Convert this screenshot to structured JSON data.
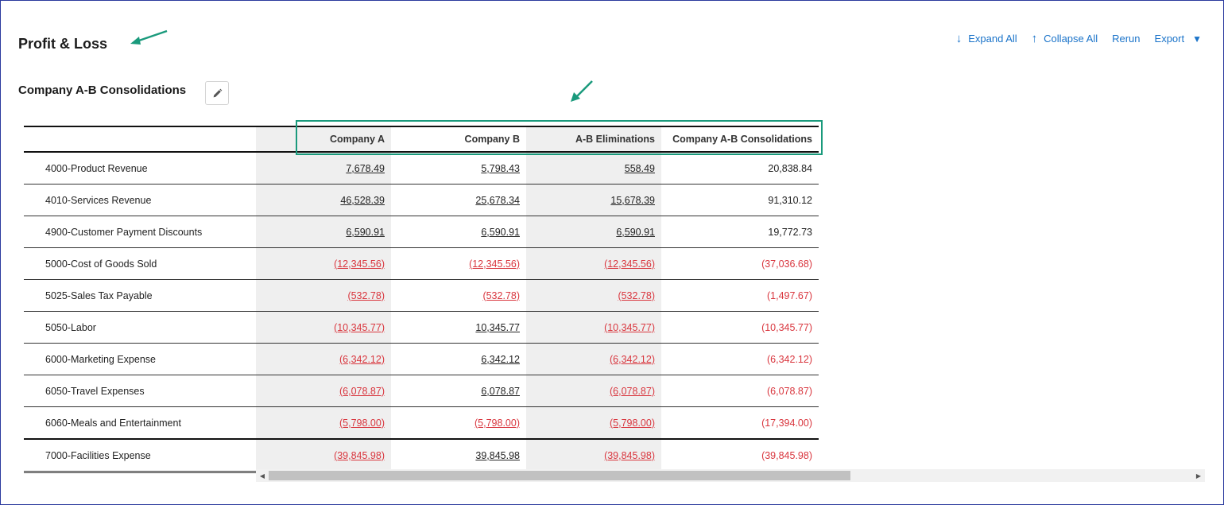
{
  "page": {
    "title": "Profit & Loss"
  },
  "report": {
    "title": "Company A-B Consolidations"
  },
  "toolbar": {
    "expand_all": "Expand All",
    "collapse_all": "Collapse All",
    "rerun": "Rerun",
    "export": "Export"
  },
  "table": {
    "headers": [
      "",
      "Company A",
      "Company B",
      "A-B Eliminations",
      "Company A-B Consolidations"
    ],
    "rows": [
      {
        "label": "4000-Product Revenue",
        "values": [
          "7,678.49",
          "5,798.43",
          "558.49",
          "20,838.84"
        ]
      },
      {
        "label": "4010-Services Revenue",
        "values": [
          "46,528.39",
          "25,678.34",
          "15,678.39",
          "91,310.12"
        ]
      },
      {
        "label": "4900-Customer Payment Discounts",
        "values": [
          "6,590.91",
          "6,590.91",
          "6,590.91",
          "19,772.73"
        ]
      },
      {
        "label": "5000-Cost of Goods Sold",
        "values": [
          "(12,345.56)",
          "(12,345.56)",
          "(12,345.56)",
          "(37,036.68)"
        ]
      },
      {
        "label": "5025-Sales Tax Payable",
        "values": [
          "(532.78)",
          "(532.78)",
          "(532.78)",
          "(1,497.67)"
        ]
      },
      {
        "label": "5050-Labor",
        "values": [
          "(10,345.77)",
          "10,345.77",
          "(10,345.77)",
          "(10,345.77)"
        ]
      },
      {
        "label": "6000-Marketing Expense",
        "values": [
          "(6,342.12)",
          "6,342.12",
          "(6,342.12)",
          "(6,342.12)"
        ]
      },
      {
        "label": "6050-Travel Expenses",
        "values": [
          "(6,078.87)",
          "6,078.87",
          "(6,078.87)",
          "(6,078.87)"
        ]
      },
      {
        "label": "6060-Meals and Entertainment",
        "values": [
          "(5,798.00)",
          "(5,798.00)",
          "(5,798.00)",
          "(17,394.00)"
        ]
      },
      {
        "label": "7000-Facilities Expense",
        "values": [
          "(39,845.98)",
          "39,845.98",
          "(39,845.98)",
          "(39,845.98)"
        ]
      }
    ]
  },
  "colors": {
    "link_blue": "#1a73c9",
    "negative_red": "#d9363e",
    "highlight_green": "#1a9a7c",
    "column_shade": "#efefef"
  },
  "icons": {
    "edit": "pencil-icon",
    "expand": "arrow-down-icon",
    "collapse": "arrow-up-icon",
    "export": "caret-down-icon"
  }
}
